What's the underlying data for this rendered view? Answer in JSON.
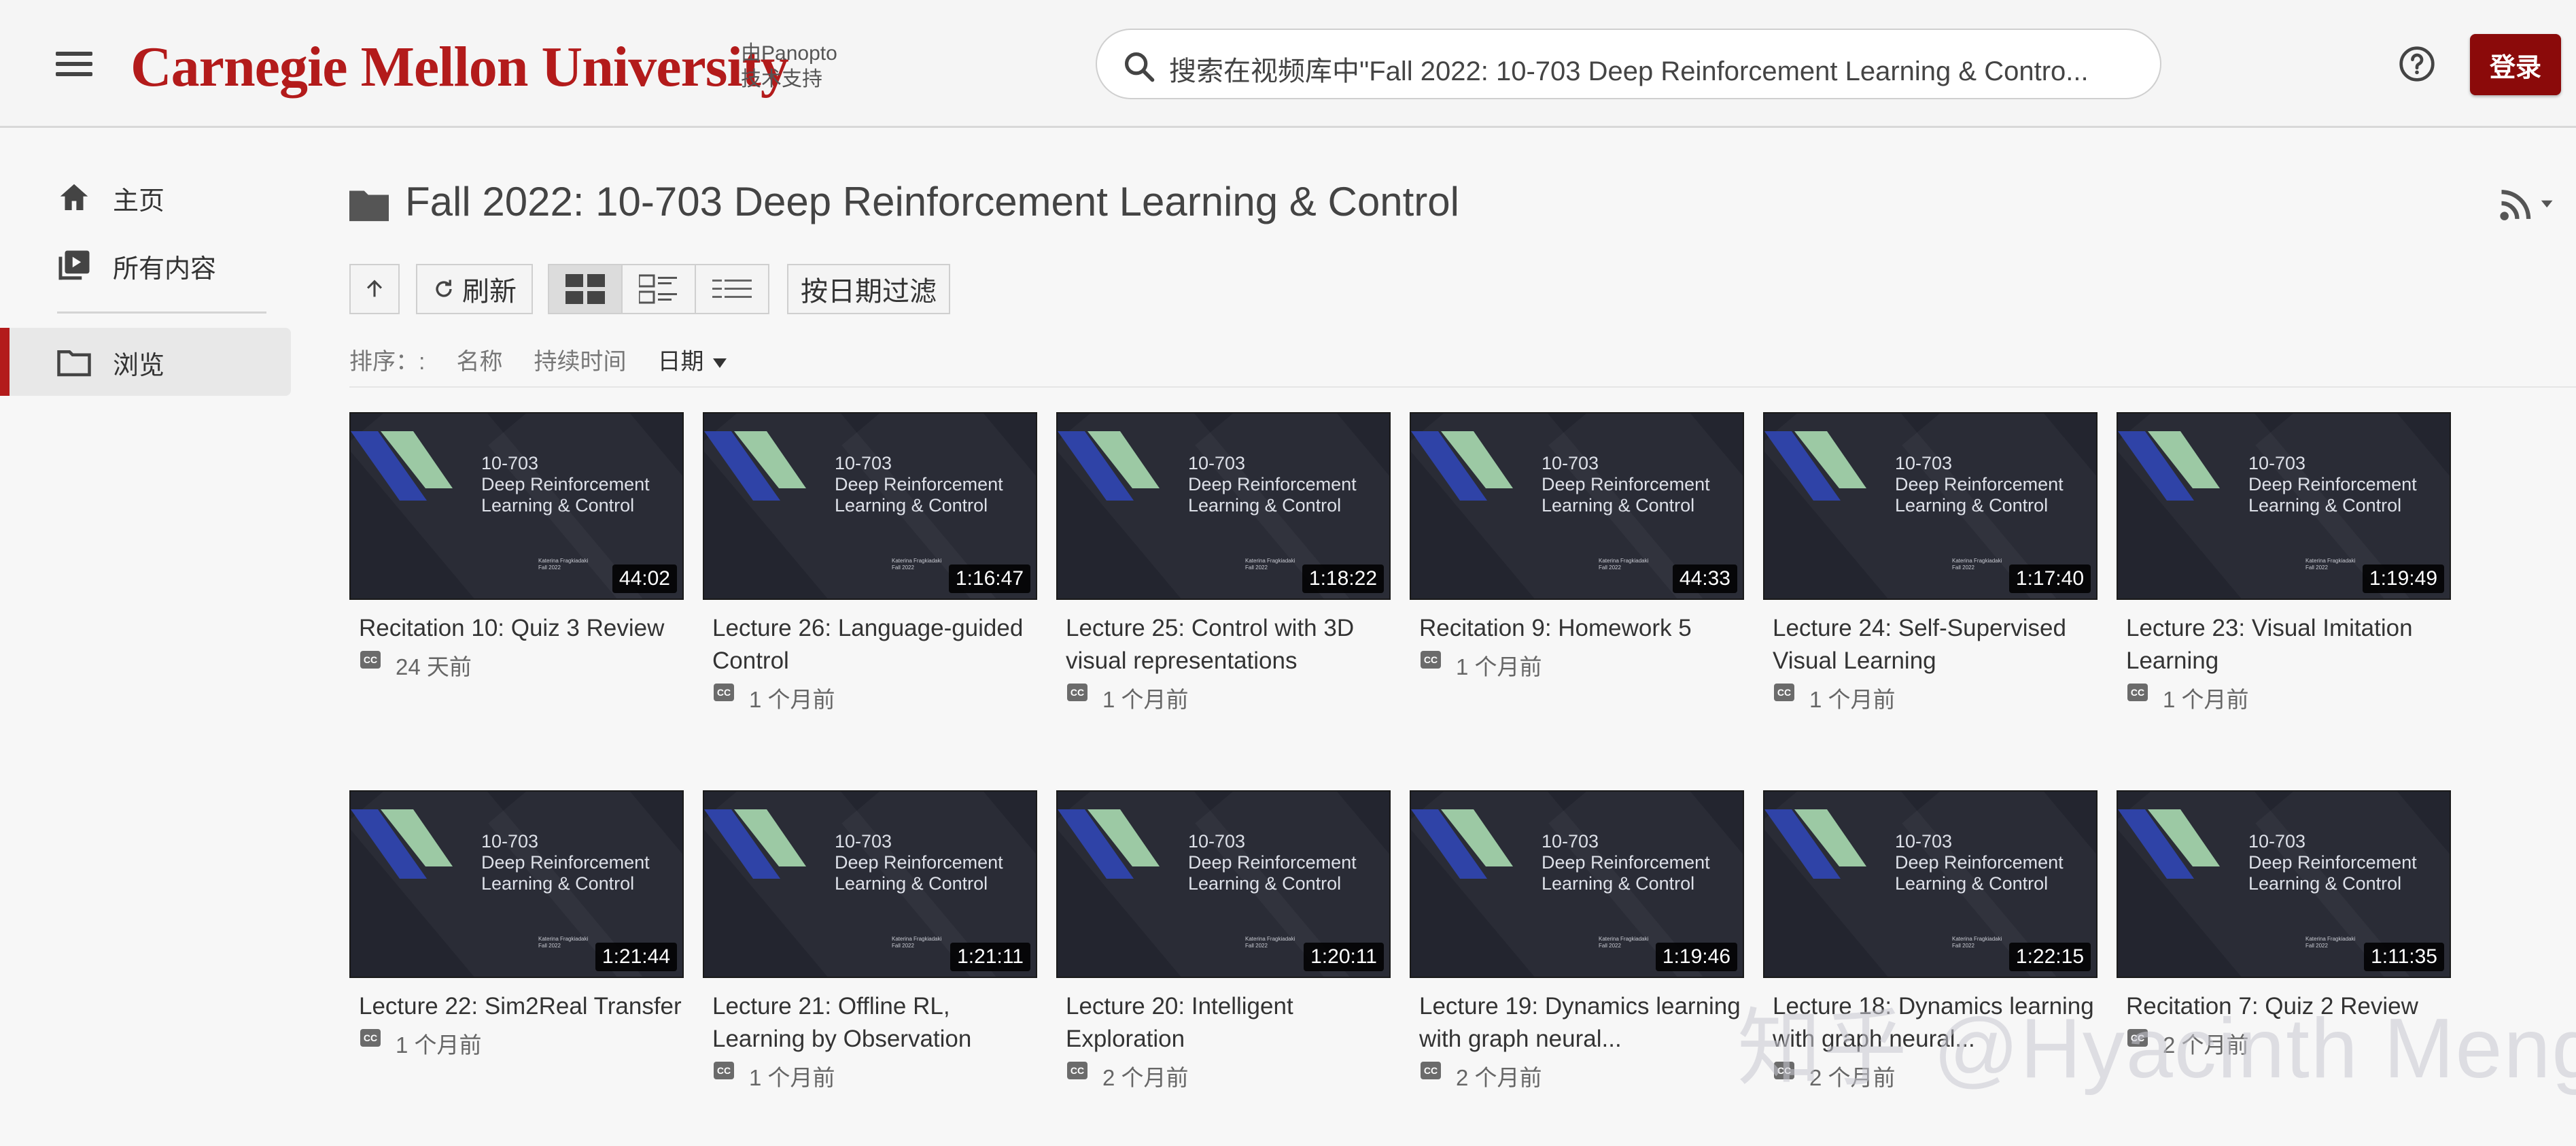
{
  "header": {
    "logo_text": "Carnegie Mellon University",
    "powered_by": "由Panopto技术支持",
    "search_placeholder": "搜索在视频库中\"Fall 2022: 10-703 Deep Reinforcement Learning & Contro...",
    "login_label": "登录"
  },
  "sidebar": {
    "items": [
      {
        "label": "主页",
        "icon": "home-icon"
      },
      {
        "label": "所有内容",
        "icon": "video-library-icon"
      },
      {
        "label": "浏览",
        "icon": "folder-icon",
        "active": true
      }
    ]
  },
  "main": {
    "title": "Fall 2022: 10-703 Deep Reinforcement Learning & Control",
    "toolbar": {
      "refresh_label": "刷新",
      "filter_label": "按日期过滤"
    },
    "sort": {
      "label": "排序：:",
      "options": [
        "名称",
        "持续时间",
        "日期"
      ],
      "active": "日期"
    },
    "thumbnail": {
      "course": "10-703",
      "line1": "Deep Reinforcement",
      "line2": "Learning & Control",
      "small1": "Katerina Fragkiadaki",
      "small2": "Fall 2022"
    },
    "videos": [
      {
        "title": "Recitation 10: Quiz 3 Review",
        "duration": "44:02",
        "age": "24 天前"
      },
      {
        "title": "Lecture 26: Language-guided Control",
        "duration": "1:16:47",
        "age": "1 个月前"
      },
      {
        "title": "Lecture 25: Control with 3D visual representations",
        "duration": "1:18:22",
        "age": "1 个月前"
      },
      {
        "title": "Recitation 9: Homework 5",
        "duration": "44:33",
        "age": "1 个月前"
      },
      {
        "title": "Lecture 24: Self-Supervised Visual Learning",
        "duration": "1:17:40",
        "age": "1 个月前"
      },
      {
        "title": "Lecture 23: Visual Imitation Learning",
        "duration": "1:19:49",
        "age": "1 个月前"
      },
      {
        "title": "Lecture 22: Sim2Real Transfer",
        "duration": "1:21:44",
        "age": "1 个月前"
      },
      {
        "title": "Lecture 21: Offline RL, Learning by Observation",
        "duration": "1:21:11",
        "age": "1 个月前"
      },
      {
        "title": "Lecture 20: Intelligent Exploration",
        "duration": "1:20:11",
        "age": "2 个月前"
      },
      {
        "title": "Lecture 19: Dynamics learning with graph neural...",
        "duration": "1:19:46",
        "age": "2 个月前"
      },
      {
        "title": "Lecture 18: Dynamics learning with graph neural...",
        "duration": "1:22:15",
        "age": "2 个月前"
      },
      {
        "title": "Recitation 7: Quiz 2 Review",
        "duration": "1:11:35",
        "age": "2 个月前"
      }
    ]
  },
  "watermark": "知乎 @Hyacinth Meng",
  "colors": {
    "brand": "#b31b1b",
    "login_bg": "#8b0a0a",
    "thumb_bg": "#23252f",
    "thumb_blue": "#2f43a7",
    "thumb_green": "#9cc9a4"
  }
}
